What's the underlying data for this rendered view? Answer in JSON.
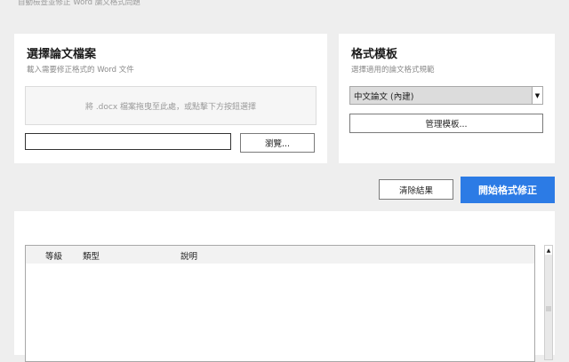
{
  "header": {
    "subtitle": "自動檢查並修正 Word 論文格式問題"
  },
  "file_section": {
    "title": "選擇論文檔案",
    "subtitle": "載入需要修正格式的 Word 文件",
    "dropzone_text": "將 .docx 檔案拖曳至此處，或點擊下方按鈕選擇",
    "path_value": "",
    "browse_label": "瀏覽..."
  },
  "template_section": {
    "title": "格式模板",
    "subtitle": "選擇適用的論文格式規範",
    "selected_template": "中文論文 (內建)",
    "manage_label": "管理模板..."
  },
  "actions": {
    "clear_label": "清除結果",
    "start_label": "開始格式修正"
  },
  "results": {
    "columns": [
      "等級",
      "類型",
      "說明"
    ]
  },
  "colors": {
    "accent": "#2c7be5",
    "background": "#eeeeee"
  },
  "icons": {
    "dropdown": "chevron-down-icon",
    "scroll_up": "arrow-up-icon"
  }
}
